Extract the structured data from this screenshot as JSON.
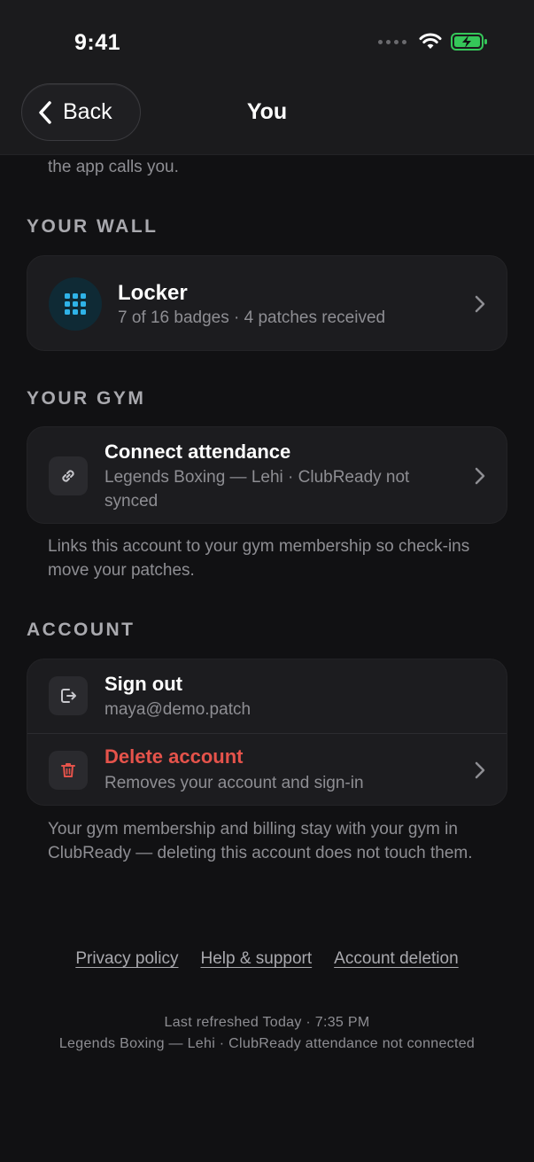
{
  "status": {
    "time": "9:41",
    "battery_color": "#35c759"
  },
  "nav": {
    "back_label": "Back",
    "title": "You"
  },
  "intro_clip": "the app calls you.",
  "sections": {
    "wall": {
      "header": "YOUR WALL",
      "locker": {
        "title": "Locker",
        "subtitle": "7 of 16 badges · 4 patches received"
      }
    },
    "gym": {
      "header": "YOUR GYM",
      "attendance": {
        "title": "Connect attendance",
        "subtitle": "Legends Boxing — Lehi · ClubReady not synced"
      },
      "note": "Links this account to your gym membership so check-ins move your patches."
    },
    "account": {
      "header": "ACCOUNT",
      "sign_out": {
        "title": "Sign out",
        "subtitle": "maya@demo.patch"
      },
      "delete": {
        "title": "Delete account",
        "subtitle": "Removes your account and sign-in"
      },
      "note": "Your gym membership and billing stay with your gym in ClubReady — deleting this account does not touch them."
    }
  },
  "links": {
    "privacy": "Privacy policy",
    "help": "Help & support",
    "deletion": "Account deletion"
  },
  "meta": {
    "refreshed": "Last refreshed Today · 7:35 PM",
    "connection": "Legends Boxing — Lehi · ClubReady attendance not connected"
  },
  "colors": {
    "accent": "#2fb3e8",
    "danger": "#e5534b",
    "background": "#111113",
    "card": "#1c1c1f"
  },
  "icons": [
    "signal-icon",
    "wifi-icon",
    "battery-icon",
    "back-chevron-icon",
    "grid-icon",
    "link-icon",
    "sign-out-icon",
    "trash-icon",
    "chevron-right-icon"
  ]
}
